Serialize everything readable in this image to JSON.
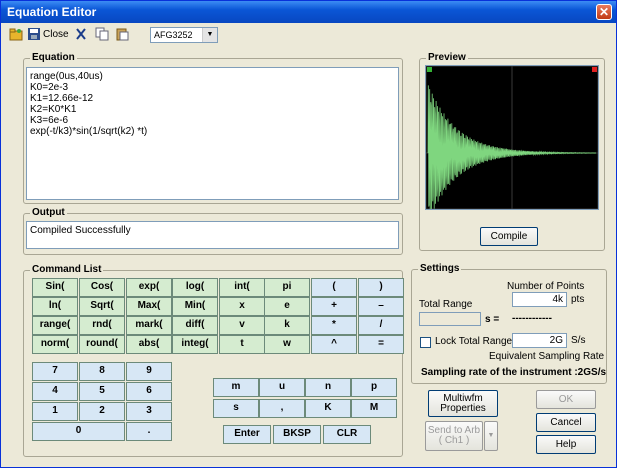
{
  "window": {
    "title": "Equation Editor"
  },
  "toolbar": {
    "close_label": "Close",
    "instrument": "AFG3252"
  },
  "equation": {
    "label": "Equation",
    "text": "range(0us,40us)\nK0=2e-3\nK1=12.66e-12\nK2=K0*K1\nK3=6e-6\nexp(-t/k3)*sin(1/sqrt(k2) *t)"
  },
  "output": {
    "label": "Output",
    "text": "Compiled Successfully"
  },
  "preview": {
    "label": "Preview",
    "compile_label": "Compile"
  },
  "command_list": {
    "label": "Command List",
    "func_rows": [
      [
        "Sin(",
        "Cos(",
        "exp(",
        "log(",
        "int(",
        "pi",
        "(",
        ")"
      ],
      [
        "ln(",
        "Sqrt(",
        "Max(",
        "Min(",
        "x",
        "e",
        "+",
        "–"
      ],
      [
        "range(",
        "rnd(",
        "mark(",
        "diff(",
        "v",
        "k",
        "*",
        "/"
      ],
      [
        "norm(",
        "round(",
        "abs(",
        "integ(",
        "t",
        "w",
        "^",
        "="
      ]
    ],
    "num_rows": [
      [
        "7",
        "8",
        "9"
      ],
      [
        "4",
        "5",
        "6"
      ],
      [
        "1",
        "2",
        "3"
      ]
    ],
    "zero": "0",
    "dot": ".",
    "letters_row1": [
      "m",
      "u",
      "n",
      "p"
    ],
    "letters_row2": [
      "s",
      ",",
      "K",
      "M"
    ],
    "enter": "Enter",
    "bksp": "BKSP",
    "clr": "CLR"
  },
  "settings": {
    "label": "Settings",
    "num_points_label": "Number of Points",
    "num_points_value": "4k",
    "pts_unit": "pts",
    "total_range_label": "Total Range",
    "total_range_value": "",
    "s_eq": "s =",
    "dashes": "------------",
    "lock_label": "Lock Total Range",
    "sample_rate_value": "2G",
    "sample_rate_unit": "S/s",
    "equiv_label": "Equivalent Sampling Rate",
    "instrument_rate": "Sampling rate of the instrument :2GS/s"
  },
  "buttons": {
    "multiwfm": "Multiwfm Properties",
    "send_to_arb": "Send to Arb ( Ch1 )",
    "ok": "OK",
    "cancel": "Cancel",
    "help": "Help"
  }
}
